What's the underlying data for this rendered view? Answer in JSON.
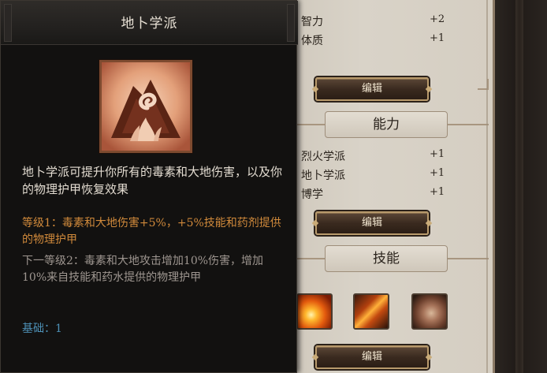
{
  "tooltip": {
    "title": "地卜学派",
    "description": "地卜学派可提升你所有的毒素和大地伤害，以及你的物理护甲恢复效果",
    "level_current": "等级1：毒素和大地伤害+5%，+5%技能和药剂提供的物理护甲",
    "level_next": "下一等级2：毒素和大地攻击增加10%伤害，增加10%来自技能和药水提供的物理护甲",
    "base": "基础：1",
    "colors": {
      "title": "#e9e2d6",
      "level_current": "#d18a3b",
      "level_next": "#9e9690",
      "base": "#4d90b6"
    },
    "icon": "geomancer-mountain-icon"
  },
  "attributes": {
    "rows": [
      {
        "name": "智力",
        "value": "+2"
      },
      {
        "name": "体质",
        "value": "+1"
      }
    ],
    "edit_label": "编辑"
  },
  "abilities": {
    "header": "能力",
    "rows": [
      {
        "name": "烈火学派",
        "value": "+1"
      },
      {
        "name": "地卜学派",
        "value": "+1"
      },
      {
        "name": "博学",
        "value": "+1"
      }
    ],
    "edit_label": "编辑"
  },
  "skills": {
    "header": "技能",
    "icons": [
      "fire-burst-icon",
      "flaming-daggers-icon",
      "boulder-icon"
    ],
    "edit_label": "编辑"
  }
}
